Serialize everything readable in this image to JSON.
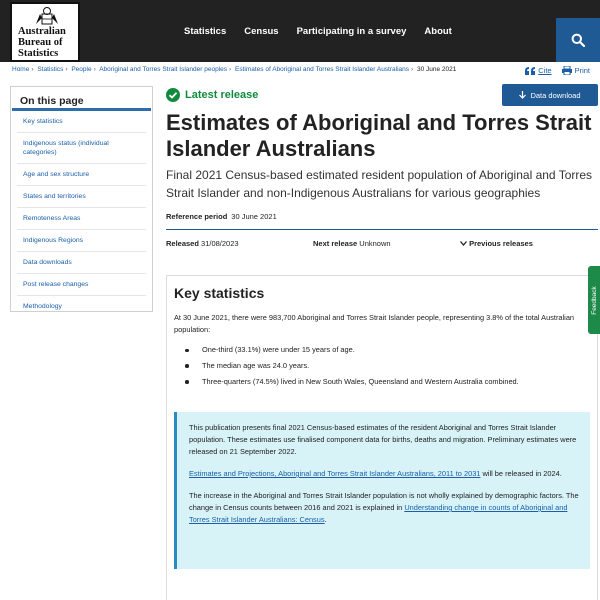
{
  "header": {
    "logo_lines": [
      "Australian",
      "Bureau of",
      "Statistics"
    ],
    "nav": [
      "Statistics",
      "Census",
      "Participating in a survey",
      "About"
    ],
    "search_icon": "search-icon"
  },
  "breadcrumb": [
    "Home",
    "Statistics",
    "People",
    "Aboriginal and Torres Strait Islander peoples",
    "Estimates of Aboriginal and Torres Strait Islander Australians",
    "30 June 2021"
  ],
  "actions": {
    "cite": "Cite",
    "print": "Print"
  },
  "sidebar": {
    "title": "On this page",
    "items": [
      "Key statistics",
      "Indigenous status (individual categories)",
      "Age and sex structure",
      "States and territories",
      "Remoteness Areas",
      "Indigenous Regions",
      "Data downloads",
      "Post release changes",
      "Methodology"
    ]
  },
  "main": {
    "latest_release": "Latest release",
    "data_download": "Data download",
    "title_line1": "Estimates of Aboriginal and Torres Strait",
    "title_line2": "Islander Australians",
    "subtitle": "Final 2021 Census-based estimated resident population of Aboriginal and Torres Strait Islander and non-Indigenous Australians for various geographies",
    "reference_period_label": "Reference period",
    "reference_period": "30 June 2021",
    "released_label": "Released",
    "released": "31/08/2023",
    "next_release_label": "Next release",
    "next_release": "Unknown",
    "previous_releases": "Previous releases"
  },
  "key_statistics": {
    "title": "Key statistics",
    "intro": "At 30 June 2021, there were 983,700 Aboriginal and Torres Strait Islander people, representing 3.8% of the total Australian population:",
    "bullets": [
      "One-third (33.1%) were under 15 years of age.",
      "The median age was 24.0 years.",
      "Three-quarters (74.5%) lived in New South Wales, Queensland and Western Australia combined."
    ],
    "info_p1": "This publication presents final 2021 Census-based estimates of the resident Aboriginal and Torres Strait Islander population. These estimates use finalised component data for births, deaths and migration. Preliminary estimates were released on 21 September 2022.",
    "info_link1": "Estimates and Projections, Aboriginal and Torres Strait Islander Australians, 2011 to 2031",
    "info_p2_tail": " will be released in 2024.",
    "info_p3": "The increase in the Aboriginal and Torres Strait Islander population is not wholly explained by demographic factors. The change in Census counts between 2016 and 2021 is explained in ",
    "info_link2": "Understanding change in counts of Aboriginal and Torres Strait Islander Australians: Census",
    "info_p3_tail": "."
  },
  "feedback": "Feedback"
}
